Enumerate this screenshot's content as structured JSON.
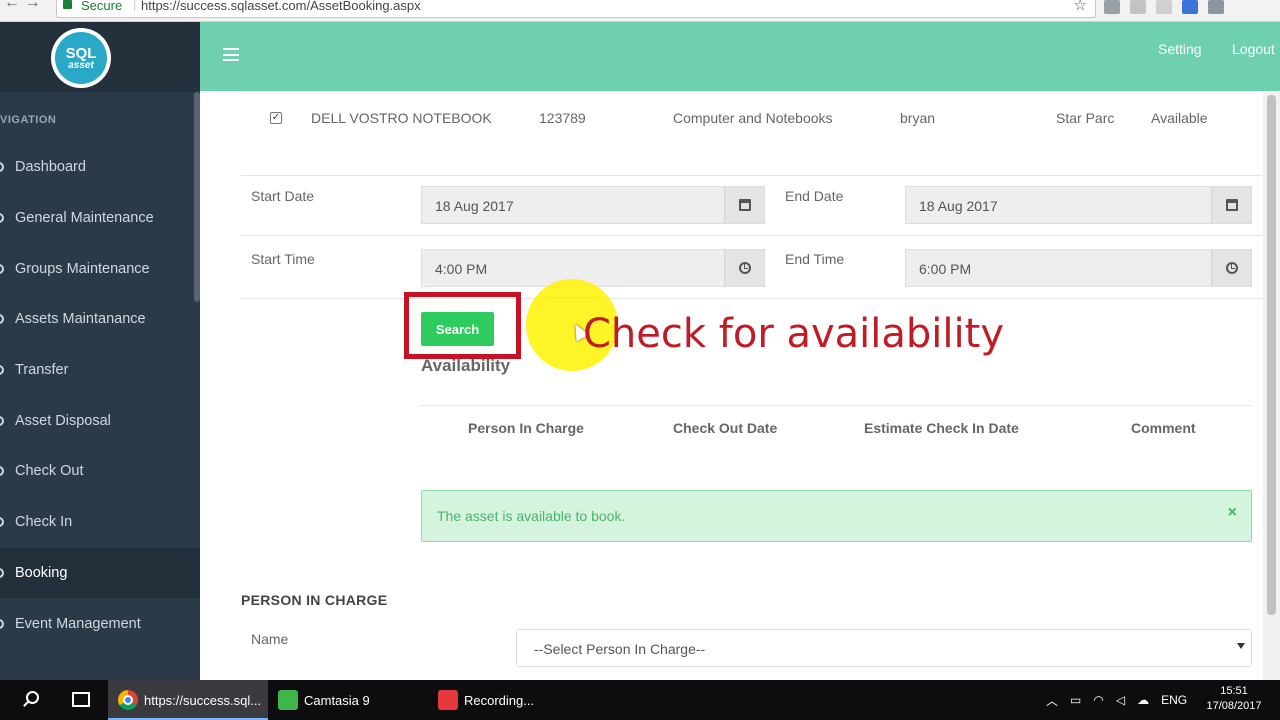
{
  "browser": {
    "secure_label": "Secure",
    "url": "https://success.sqlasset.com/AssetBooking.aspx"
  },
  "sidebar": {
    "logo_line1": "SQL",
    "logo_line2": "asset",
    "nav_label": "VIGATION",
    "items": [
      {
        "label": "Dashboard"
      },
      {
        "label": "General Maintenance"
      },
      {
        "label": "Groups Maintenance"
      },
      {
        "label": "Assets Maintanance"
      },
      {
        "label": "Transfer"
      },
      {
        "label": "Asset Disposal"
      },
      {
        "label": "Check Out"
      },
      {
        "label": "Check In"
      },
      {
        "label": "Booking"
      },
      {
        "label": "Event Management"
      }
    ],
    "active_item": "Booking"
  },
  "header": {
    "setting_label": "Setting",
    "logout_label": "Logout"
  },
  "asset_row": {
    "name": "DELL VOSTRO NOTEBOOK",
    "code": "123789",
    "category": "Computer and Notebooks",
    "user": "bryan",
    "location": "Star Parc",
    "status": "Available"
  },
  "form": {
    "start_date_label": "Start Date",
    "start_date_value": "18 Aug 2017",
    "end_date_label": "End Date",
    "end_date_value": "18 Aug 2017",
    "start_time_label": "Start Time",
    "start_time_value": "4:00 PM",
    "end_time_label": "End Time",
    "end_time_value": "6:00 PM",
    "search_label": "Search"
  },
  "annotation": {
    "text": "Check for availability",
    "color": "#c01c28"
  },
  "availability": {
    "title": "Availability",
    "columns": [
      "Person In Charge",
      "Check Out Date",
      "Estimate Check In Date",
      "Comment"
    ],
    "alert_message": "The asset is available to book.",
    "alert_close": "×"
  },
  "person_in_charge": {
    "section_title": "PERSON IN CHARGE",
    "name_label": "Name",
    "select_value": "--Select Person In Charge--"
  },
  "taskbar": {
    "apps": [
      {
        "label": "https://success.sql..."
      },
      {
        "label": "Camtasia 9"
      },
      {
        "label": "Recording..."
      }
    ],
    "language": "ENG",
    "time": "15:51",
    "date": "17/08/2017"
  },
  "colors": {
    "header_bg": "#6fd0b0",
    "sidebar_bg": "#2b3a48",
    "search_button": "#2ecc5f",
    "alert_bg": "#d4f4dd"
  }
}
